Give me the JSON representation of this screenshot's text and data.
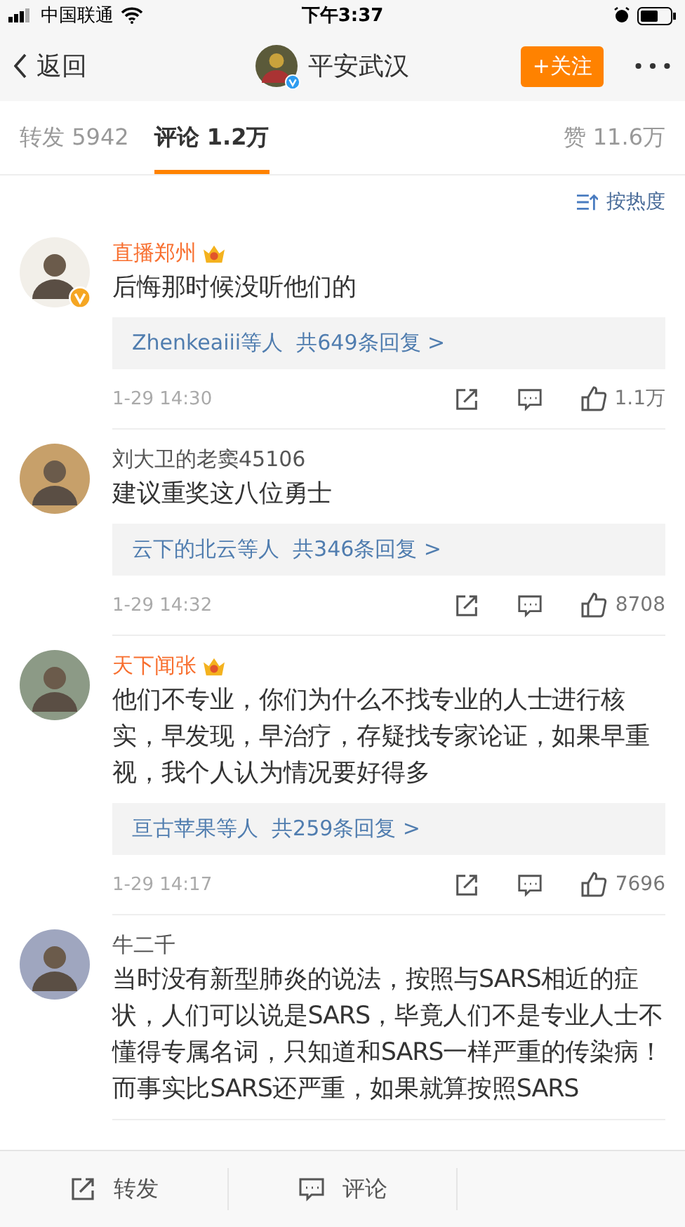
{
  "status_bar": {
    "carrier": "中国联通",
    "time": "下午3:37"
  },
  "nav": {
    "back": "返回",
    "title": "平安武汉",
    "badge": {
      "color": "#2d9cf0"
    },
    "follow_button": "+关注"
  },
  "tabs": [
    {
      "label": "转发 5942",
      "selected": false
    },
    {
      "label": "评论 1.2万",
      "selected": true
    },
    {
      "label": "赞 11.6万",
      "selected": false
    }
  ],
  "sort": "按热度",
  "comments": [
    {
      "author": "直播郑州",
      "vip": true,
      "badge": {
        "color": "#f5a623"
      },
      "text": "后悔那时候没听他们的",
      "replies": "Zhenkeaiii等人  共649条回复 >",
      "time": "1-29 14:30",
      "likes": "1.1万"
    },
    {
      "author": "刘大卫的老窦45106",
      "vip": false,
      "text": "建议重奖这八位勇士",
      "replies": "云下的北云等人  共346条回复 >",
      "time": "1-29 14:32",
      "likes": "8708"
    },
    {
      "author": "天下闻张",
      "vip": true,
      "text": "他们不专业，你们为什么不找专业的人士进行核实，早发现，早治疗，存疑找专家论证，如果早重视，我个人认为情况要好得多",
      "replies": "亘古苹果等人  共259条回复 >",
      "time": "1-29 14:17",
      "likes": "7696"
    },
    {
      "author": "牛二千",
      "vip": false,
      "text": "当时没有新型肺炎的说法，按照与SARS相近的症状，人们可以说是SARS，毕竟人们不是专业人士不懂得专属名词，只知道和SARS一样严重的传染病！而事实比SARS还严重，如果就算按照SARS"
    }
  ],
  "bottom_bar": [
    {
      "label": "转发",
      "kind": "repost"
    },
    {
      "label": "评论",
      "kind": "comment"
    }
  ]
}
